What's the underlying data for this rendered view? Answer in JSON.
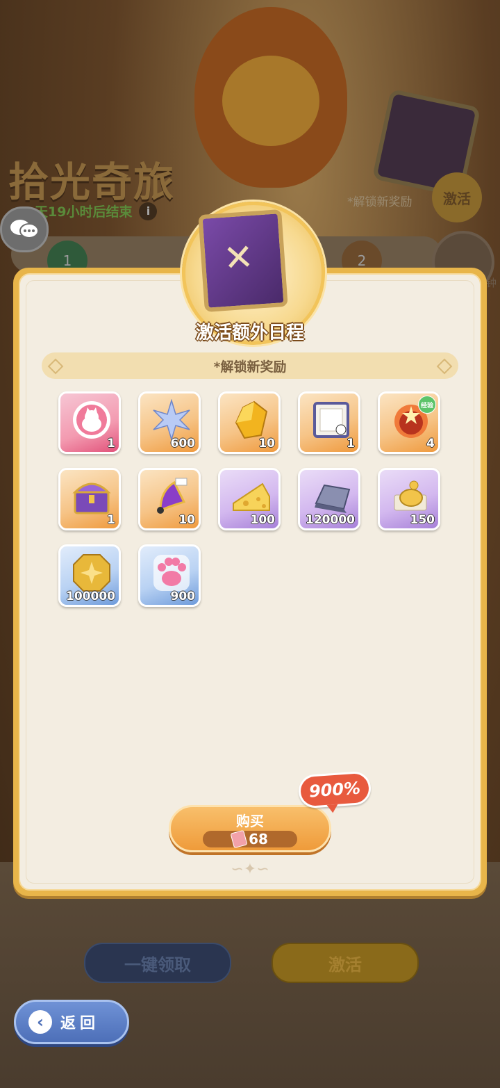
{
  "background": {
    "event_title": "拾光奇旅",
    "timer_text": "天19小时后结束",
    "unlock_text": "*解锁新奖励",
    "activate_label": "激活",
    "track_nodes": [
      "1",
      "2"
    ],
    "side_text": "钟",
    "claim_all_label": "一键领取",
    "activate_button_label": "激活"
  },
  "modal": {
    "title": "激活额外日程",
    "subtitle": "*解锁新奖励",
    "rewards": [
      {
        "icon": "cat-avatar-icon",
        "qty": "1",
        "rarity": "pink"
      },
      {
        "icon": "star-crystal-icon",
        "qty": "600",
        "rarity": "orange"
      },
      {
        "icon": "gold-gem-icon",
        "qty": "10",
        "rarity": "orange"
      },
      {
        "icon": "frame-card-icon",
        "qty": "1",
        "rarity": "orange"
      },
      {
        "icon": "exp-potion-icon",
        "qty": "4",
        "rarity": "orange",
        "badge": "经验"
      },
      {
        "icon": "treasure-chest-icon",
        "qty": "1",
        "rarity": "orange"
      },
      {
        "icon": "bell-icon",
        "qty": "10",
        "rarity": "orange"
      },
      {
        "icon": "cheese-icon",
        "qty": "100",
        "rarity": "purple"
      },
      {
        "icon": "iron-ingot-icon",
        "qty": "120000",
        "rarity": "purple"
      },
      {
        "icon": "coin-plate-icon",
        "qty": "150",
        "rarity": "purple"
      },
      {
        "icon": "gold-coin-icon",
        "qty": "100000",
        "rarity": "blue"
      },
      {
        "icon": "paw-candy-icon",
        "qty": "900",
        "rarity": "blue"
      }
    ],
    "buy_label": "购买",
    "price": "68",
    "discount": "900%"
  },
  "back_button_label": "返回",
  "colors": {
    "modal_border": "#e8b54a",
    "modal_bg": "#f3ede1",
    "buy_button": "#ef9b3a",
    "discount_badge": "#e85a3e",
    "back_button": "#4d6fb8"
  }
}
